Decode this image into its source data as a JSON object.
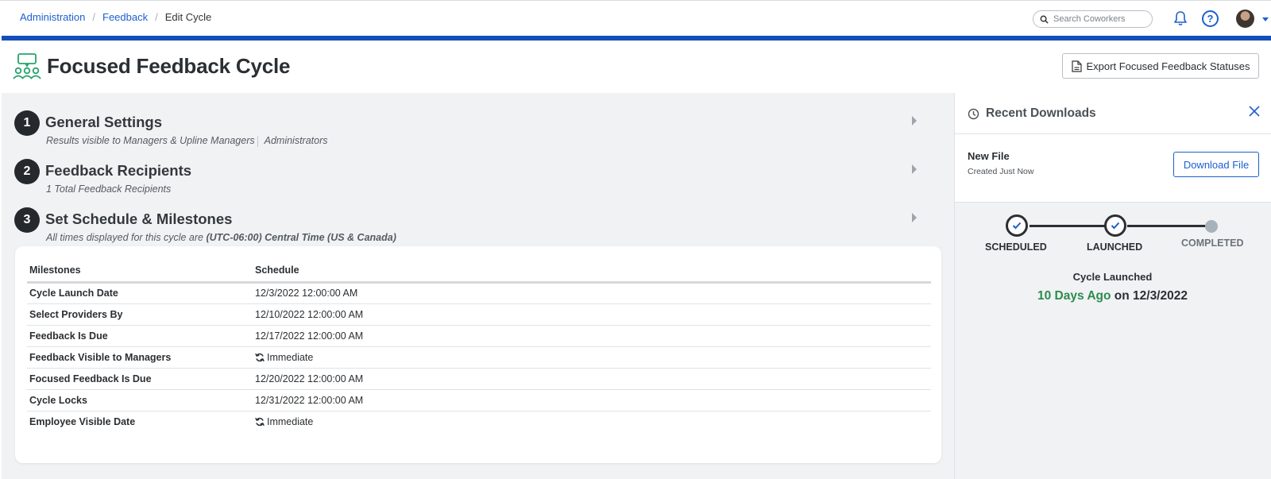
{
  "breadcrumb": {
    "items": [
      "Administration",
      "Feedback"
    ],
    "current": "Edit Cycle"
  },
  "topbar": {
    "search_placeholder": "Search Coworkers",
    "help_label": "?",
    "accent_color": "#1250b8"
  },
  "header": {
    "title": "Focused Feedback Cycle",
    "export_label": "Export Focused Feedback Statuses"
  },
  "steps": [
    {
      "number": "1",
      "title": "General Settings",
      "sub_part1": "Results visible to Managers & Upline Managers",
      "sub_part2": "Administrators"
    },
    {
      "number": "2",
      "title": "Feedback Recipients",
      "sub": "1 Total Feedback Recipients"
    },
    {
      "number": "3",
      "title": "Set Schedule & Milestones",
      "sub_prefix": "All times displayed for this cycle are ",
      "sub_bold": "(UTC-06:00) Central Time (US & Canada)"
    }
  ],
  "schedule": {
    "headers": [
      "Milestones",
      "Schedule"
    ],
    "rows": [
      {
        "milestone": "Cycle Launch Date",
        "schedule": "12/3/2022 12:00:00 AM"
      },
      {
        "milestone": "Select Providers By",
        "schedule": "12/10/2022 12:00:00 AM"
      },
      {
        "milestone": "Feedback Is Due",
        "schedule": "12/17/2022 12:00:00 AM"
      },
      {
        "milestone": "Feedback Visible to Managers",
        "schedule": "Immediate"
      },
      {
        "milestone": "Focused Feedback Is Due",
        "schedule": "12/20/2022 12:00:00 AM"
      },
      {
        "milestone": "Cycle Locks",
        "schedule": "12/31/2022 12:00:00 AM"
      },
      {
        "milestone": "Employee Visible Date",
        "schedule": "Immediate"
      }
    ]
  },
  "recent_downloads": {
    "title": "Recent Downloads",
    "file_name": "New File",
    "file_time": "Created Just Now",
    "download_label": "Download File"
  },
  "progress": {
    "stages": [
      "SCHEDULED",
      "LAUNCHED",
      "COMPLETED"
    ],
    "status": "Cycle Launched",
    "ago": "10 Days Ago",
    "on_date": " on 12/3/2022",
    "done_color": "#2b2f33",
    "pending_color": "#a8b2bd",
    "highlight_color": "#2a8c4e"
  }
}
